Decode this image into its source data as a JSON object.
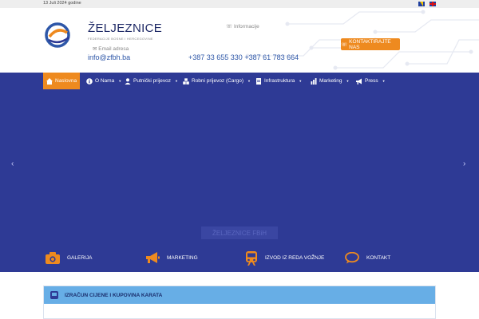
{
  "topbar": {
    "date": "13 Juli 2024 godine"
  },
  "header": {
    "brand": "ŽELJEZNICE",
    "brand_sub": "FEDERACIJE BOSNE I HERCEGOVINE",
    "email_label": "Email adresa",
    "email_value": "info@zfbh.ba",
    "info_label": "Informacije",
    "info_value": "+387 33 655 330 +387 61 783 664",
    "cta_label": "KONTAKTIRAJTE NAS"
  },
  "nav": {
    "items": [
      {
        "label": "Naslovna",
        "icon": "home-icon"
      },
      {
        "label": "O Nama",
        "icon": "info-icon"
      },
      {
        "label": "Putnički prijevoz",
        "icon": "user-icon"
      },
      {
        "label": "Robni prijevoz (Cargo)",
        "icon": "boxes-icon"
      },
      {
        "label": "Infrastruktura",
        "icon": "document-icon"
      },
      {
        "label": "Marketing",
        "icon": "bar-chart-icon"
      },
      {
        "label": "Press",
        "icon": "bullhorn-icon"
      }
    ]
  },
  "hero": {
    "caption": "ŽELJEZNICE FBiH"
  },
  "quick_links": [
    {
      "label": "GALERIJA",
      "icon": "camera-icon"
    },
    {
      "label": "MARKETING",
      "icon": "megaphone-icon"
    },
    {
      "label": "IZVOD IZ REDA VOŽNJE",
      "icon": "train-icon"
    },
    {
      "label": "KONTAKT",
      "icon": "chat-bubble-icon"
    }
  ],
  "panel": {
    "title": "IZRAČUN CIJENE I KUPOVINA KARATA"
  },
  "colors": {
    "primary": "#2e3a95",
    "accent": "#ee8a1f",
    "panel": "#67aee6"
  }
}
